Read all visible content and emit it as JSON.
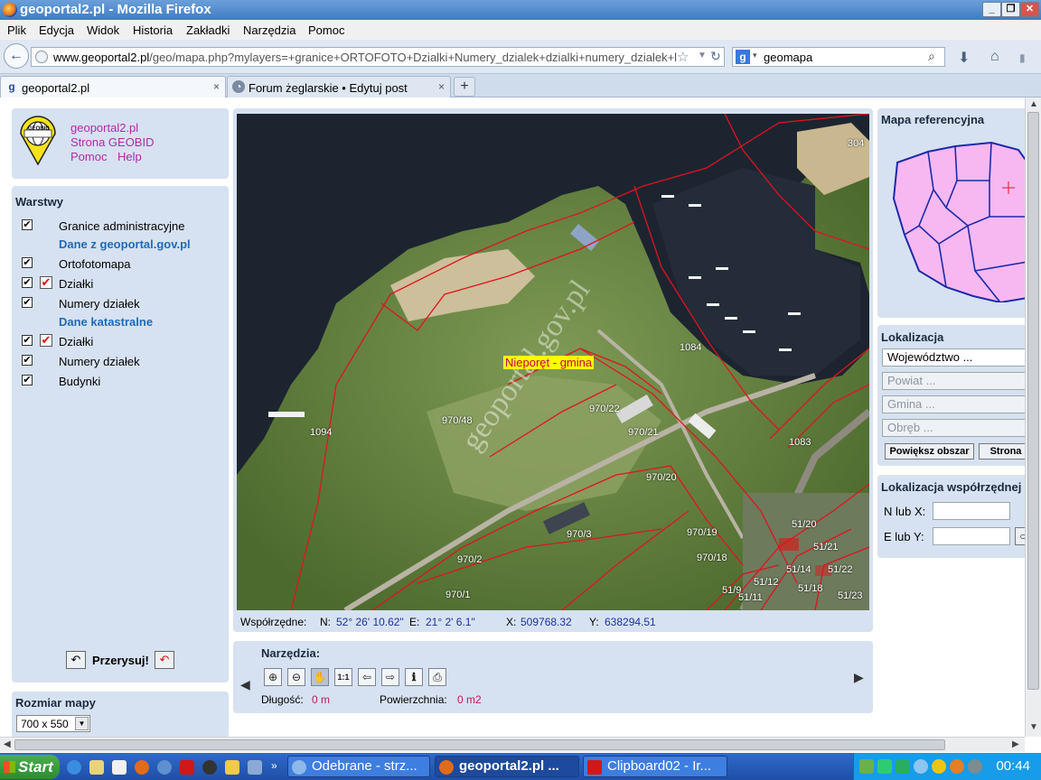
{
  "window": {
    "title": "geoportal2.pl - Mozilla Firefox",
    "minimize": "_",
    "restore": "❐",
    "close": "✕"
  },
  "menu": [
    "Plik",
    "Edycja",
    "Widok",
    "Historia",
    "Zakładki",
    "Narzędzia",
    "Pomoc"
  ],
  "nav": {
    "url_domain": "www.geoportal2.pl",
    "url_path": "/geo/mapa.php?mylayers=+granice+ORTOFOTO+Dzialki+Numery_dzialek+dzialki+numery_dzialek+l",
    "search_value": "geomapa"
  },
  "tabs": [
    {
      "label": "geoportal2.pl",
      "close": "×",
      "active": true
    },
    {
      "label": "Forum żeglarskie • Edytuj post",
      "close": "×",
      "active": false
    }
  ],
  "newtab": "+",
  "header": {
    "logo_text": "GEOBID",
    "link1": "geoportal2.pl",
    "link2": "Strona GEOBID",
    "link3": "Pomoc",
    "link4": "Help"
  },
  "layers": {
    "title": "Warstwy",
    "items": [
      {
        "label": "Granice administracyjne"
      },
      {
        "label": "Dane z geoportal.gov.pl"
      },
      {
        "label": "Ortofotomapa"
      },
      {
        "label": "Działki"
      },
      {
        "label": "Numery działek"
      },
      {
        "label": "Dane katastralne"
      },
      {
        "label": "Działki"
      },
      {
        "label": "Numery działek"
      },
      {
        "label": "Budynki"
      }
    ],
    "redraw": "Przerysuj!"
  },
  "mapsize": {
    "title": "Rozmiar mapy",
    "value": "700 x 550"
  },
  "map": {
    "gmina_label": "Nieporęt - gmina",
    "watermark": "geoportal.gov.pl",
    "parcels": [
      "304",
      "1084",
      "1094",
      "970/48",
      "970/22",
      "970/21",
      "970/20",
      "1083",
      "970/3",
      "970/19",
      "970/2",
      "970/18",
      "970/1",
      "51/20",
      "51/21",
      "51/14",
      "51/22",
      "51/12",
      "51/18",
      "51/9",
      "51/11",
      "51/23"
    ]
  },
  "coords": {
    "label": "Współrzędne:",
    "n_label": "N:",
    "n_value": "52° 26' 10.62\"",
    "e_label": "E:",
    "e_value": "21° 2' 6.1\"",
    "x_label": "X:",
    "x_value": "509768.32",
    "y_label": "Y:",
    "y_value": "638294.51"
  },
  "tools": {
    "title": "Narzędzia:",
    "length_label": "Długość:",
    "length_value": "0 m",
    "area_label": "Powierzchnia:",
    "area_value": "0 m2",
    "buttons": [
      "⊕",
      "⊖",
      "✋",
      "1:1",
      "⇦",
      "⇨",
      "ℹ",
      "⎙"
    ]
  },
  "refmap": {
    "title": "Mapa referencyjna"
  },
  "localization": {
    "title": "Lokalizacja",
    "wojewodztwo": "Województwo ...",
    "powiat": "Powiat ...",
    "gmina": "Gmina ...",
    "obreb": "Obręb ...",
    "zoom_btn": "Powiększ obszar",
    "page_btn": "Strona"
  },
  "coordloc": {
    "title": "Lokalizacja współrzędnej",
    "n_label": "N lub X:",
    "e_label": "E lub Y:"
  },
  "taskbar": {
    "start": "Start",
    "tasks": [
      {
        "label": "Odebrane - strz..."
      },
      {
        "label": "geoportal2.pl ..."
      },
      {
        "label": "Clipboard02 - Ir..."
      }
    ],
    "clock": "00:44"
  },
  "colors": {
    "panel": "#d6e2f1",
    "link": "#b02aa8",
    "section": "#1f6bb8",
    "parcel_line": "#e0141e",
    "gmina_bg": "#ffff00"
  }
}
